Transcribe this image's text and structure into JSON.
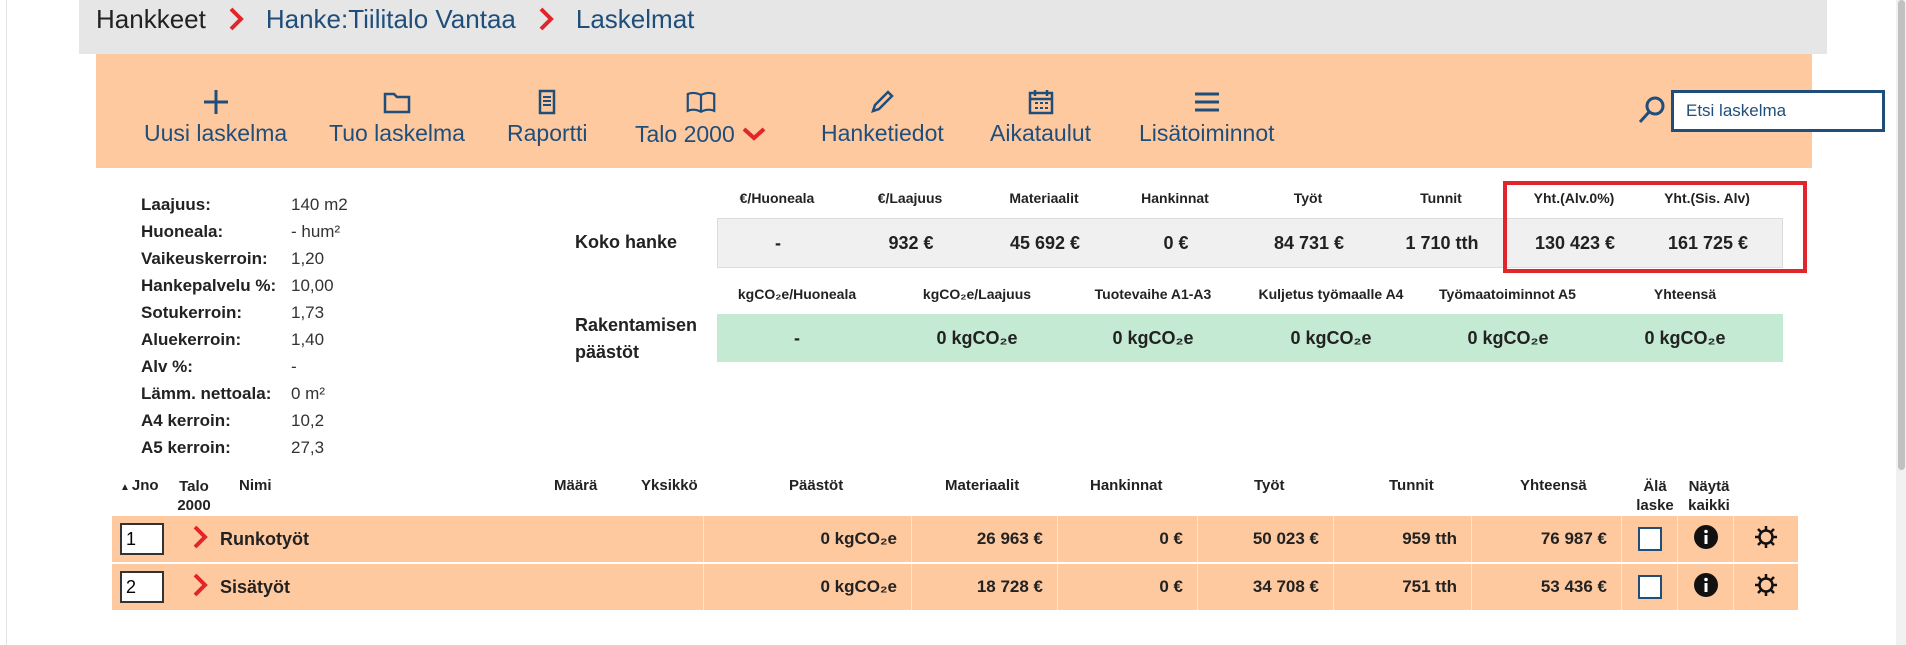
{
  "breadcrumb": {
    "items": [
      "Hankkeet",
      "Hanke:Tiilitalo Vantaa",
      "Laskelmat"
    ]
  },
  "toolbar": {
    "items": [
      {
        "label": "Uusi laskelma",
        "icon": "plus-icon"
      },
      {
        "label": "Tuo laskelma",
        "icon": "folder-icon"
      },
      {
        "label": "Raportti",
        "icon": "document-icon"
      },
      {
        "label": "Talo 2000",
        "icon": "book-icon"
      },
      {
        "label": "Hanketiedot",
        "icon": "pencil-icon"
      },
      {
        "label": "Aikataulut",
        "icon": "calendar-icon"
      },
      {
        "label": "Lisätoiminnot",
        "icon": "menu-icon"
      }
    ],
    "search_placeholder": "Etsi laskelma"
  },
  "info": [
    {
      "key": "Laajuus:",
      "value": "140 m2"
    },
    {
      "key": "Huoneala:",
      "value": "- hum²"
    },
    {
      "key": "Vaikeuskerroin:",
      "value": "1,20"
    },
    {
      "key": "Hankepalvelu %:",
      "value": "10,00"
    },
    {
      "key": "Sotukerroin:",
      "value": "1,73"
    },
    {
      "key": "Aluekerroin:",
      "value": "1,40"
    },
    {
      "key": "Alv %:",
      "value": "-"
    },
    {
      "key": "Lämm. nettoala:",
      "value": "0 m²"
    },
    {
      "key": "A4 kerroin:",
      "value": "10,2"
    },
    {
      "key": "A5 kerroin:",
      "value": "27,3"
    }
  ],
  "costs": {
    "label": "Koko hanke",
    "headers": [
      "€/Huoneala",
      "€/Laajuus",
      "Materiaalit",
      "Hankinnat",
      "Työt",
      "Tunnit",
      "Yht.(Alv.0%)",
      "Yht.(Sis. Alv)"
    ],
    "values": [
      "-",
      "932 €",
      "45 692 €",
      "0 €",
      "84 731 €",
      "1 710 tth",
      "130 423 €",
      "161 725 €"
    ]
  },
  "emissions": {
    "label_line1": "Rakentamisen",
    "label_line2": "päästöt",
    "headers": [
      "kgCO₂e/Huoneala",
      "kgCO₂e/Laajuus",
      "Tuotevaihe A1-A3",
      "Kuljetus työmaalle A4",
      "Työmaatoiminnot A5",
      "Yhteensä"
    ],
    "values": [
      "-",
      "0 kgCO₂e",
      "0 kgCO₂e",
      "0 kgCO₂e",
      "0 kgCO₂e",
      "0 kgCO₂e"
    ]
  },
  "list": {
    "headers": {
      "jno": "Jno",
      "talo_line1": "Talo",
      "talo_line2": "2000",
      "nimi": "Nimi",
      "maara": "Määrä",
      "yksikko": "Yksikkö",
      "paastot": "Päästöt",
      "materiaalit": "Materiaalit",
      "hankinnat": "Hankinnat",
      "tyot": "Työt",
      "tunnit": "Tunnit",
      "yhteensa": "Yhteensä",
      "ala_line1": "Älä",
      "ala_line2": "laske",
      "nayta_line1": "Näytä",
      "nayta_line2": "kaikki"
    },
    "rows": [
      {
        "jno": "1",
        "name": "Runkotyöt",
        "paastot": "0 kgCO₂e",
        "materiaalit": "26 963 €",
        "hankinnat": "0 €",
        "tyot": "50 023 €",
        "tunnit": "959 tth",
        "yhteensa": "76 987 €"
      },
      {
        "jno": "2",
        "name": "Sisätyöt",
        "paastot": "0 kgCO₂e",
        "materiaalit": "18 728 €",
        "hankinnat": "0 €",
        "tyot": "34 708 €",
        "tunnit": "751 tth",
        "yhteensa": "53 436 €"
      }
    ]
  },
  "colors": {
    "accent_orange": "#ffc9a0",
    "link_blue": "#1f4e7a",
    "red": "#e0262b",
    "emission_green": "#c4ead3"
  }
}
